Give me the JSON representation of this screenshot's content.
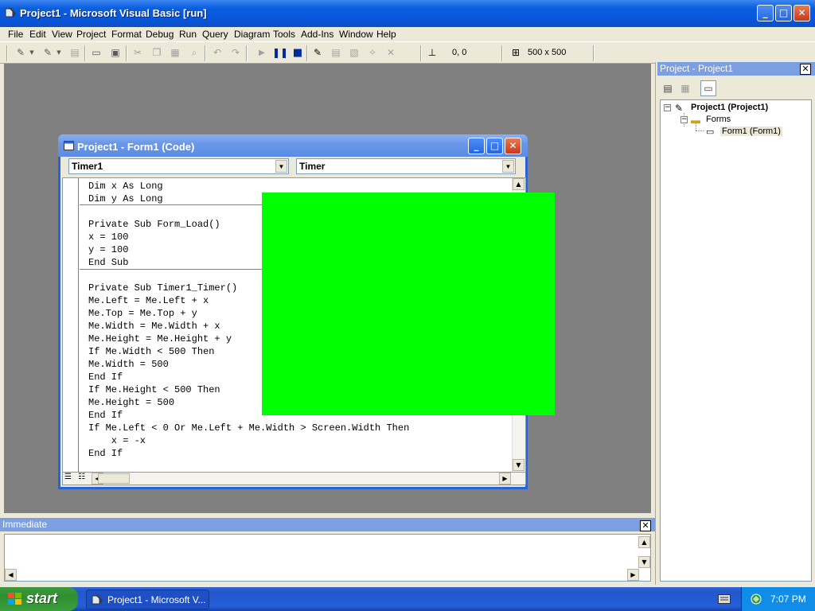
{
  "window": {
    "title": "Project1 - Microsoft Visual Basic [run]",
    "minimize": "_",
    "maximize": "□",
    "close": "✕"
  },
  "menu": [
    "File",
    "Edit",
    "View",
    "Project",
    "Format",
    "Debug",
    "Run",
    "Query",
    "Diagram",
    "Tools",
    "Add-Ins",
    "Window",
    "Help"
  ],
  "toolbar": {
    "position": "0, 0",
    "size": "500 x 500"
  },
  "code_window": {
    "title": "Project1 - Form1 (Code)",
    "object_combo": "Timer1",
    "proc_combo": "Timer",
    "lines": [
      "Dim x As Long",
      "Dim y As Long",
      "",
      "Private Sub Form_Load()",
      "x = 100",
      "y = 100",
      "End Sub",
      "",
      "Private Sub Timer1_Timer()",
      "Me.Left = Me.Left + x",
      "Me.Top = Me.Top + y",
      "Me.Width = Me.Width + x",
      "Me.Height = Me.Height + y",
      "If Me.Width < 500 Then",
      "Me.Width = 500",
      "End If",
      "If Me.Height < 500 Then",
      "Me.Height = 500",
      "End If",
      "If Me.Left < 0 Or Me.Left + Me.Width > Screen.Width Then",
      "    x = -x",
      "End If"
    ]
  },
  "running_form_color": "#00ff00",
  "project": {
    "title": "Project - Project1",
    "close": "✕",
    "root": "Project1 (Project1)",
    "folder": "Forms",
    "item": "Form1 (Form1)"
  },
  "immediate": {
    "title": "Immediate",
    "close": "✕"
  },
  "taskbar": {
    "start": "start",
    "task": "Project1 - Microsoft V...",
    "clock": "7:07 PM"
  }
}
